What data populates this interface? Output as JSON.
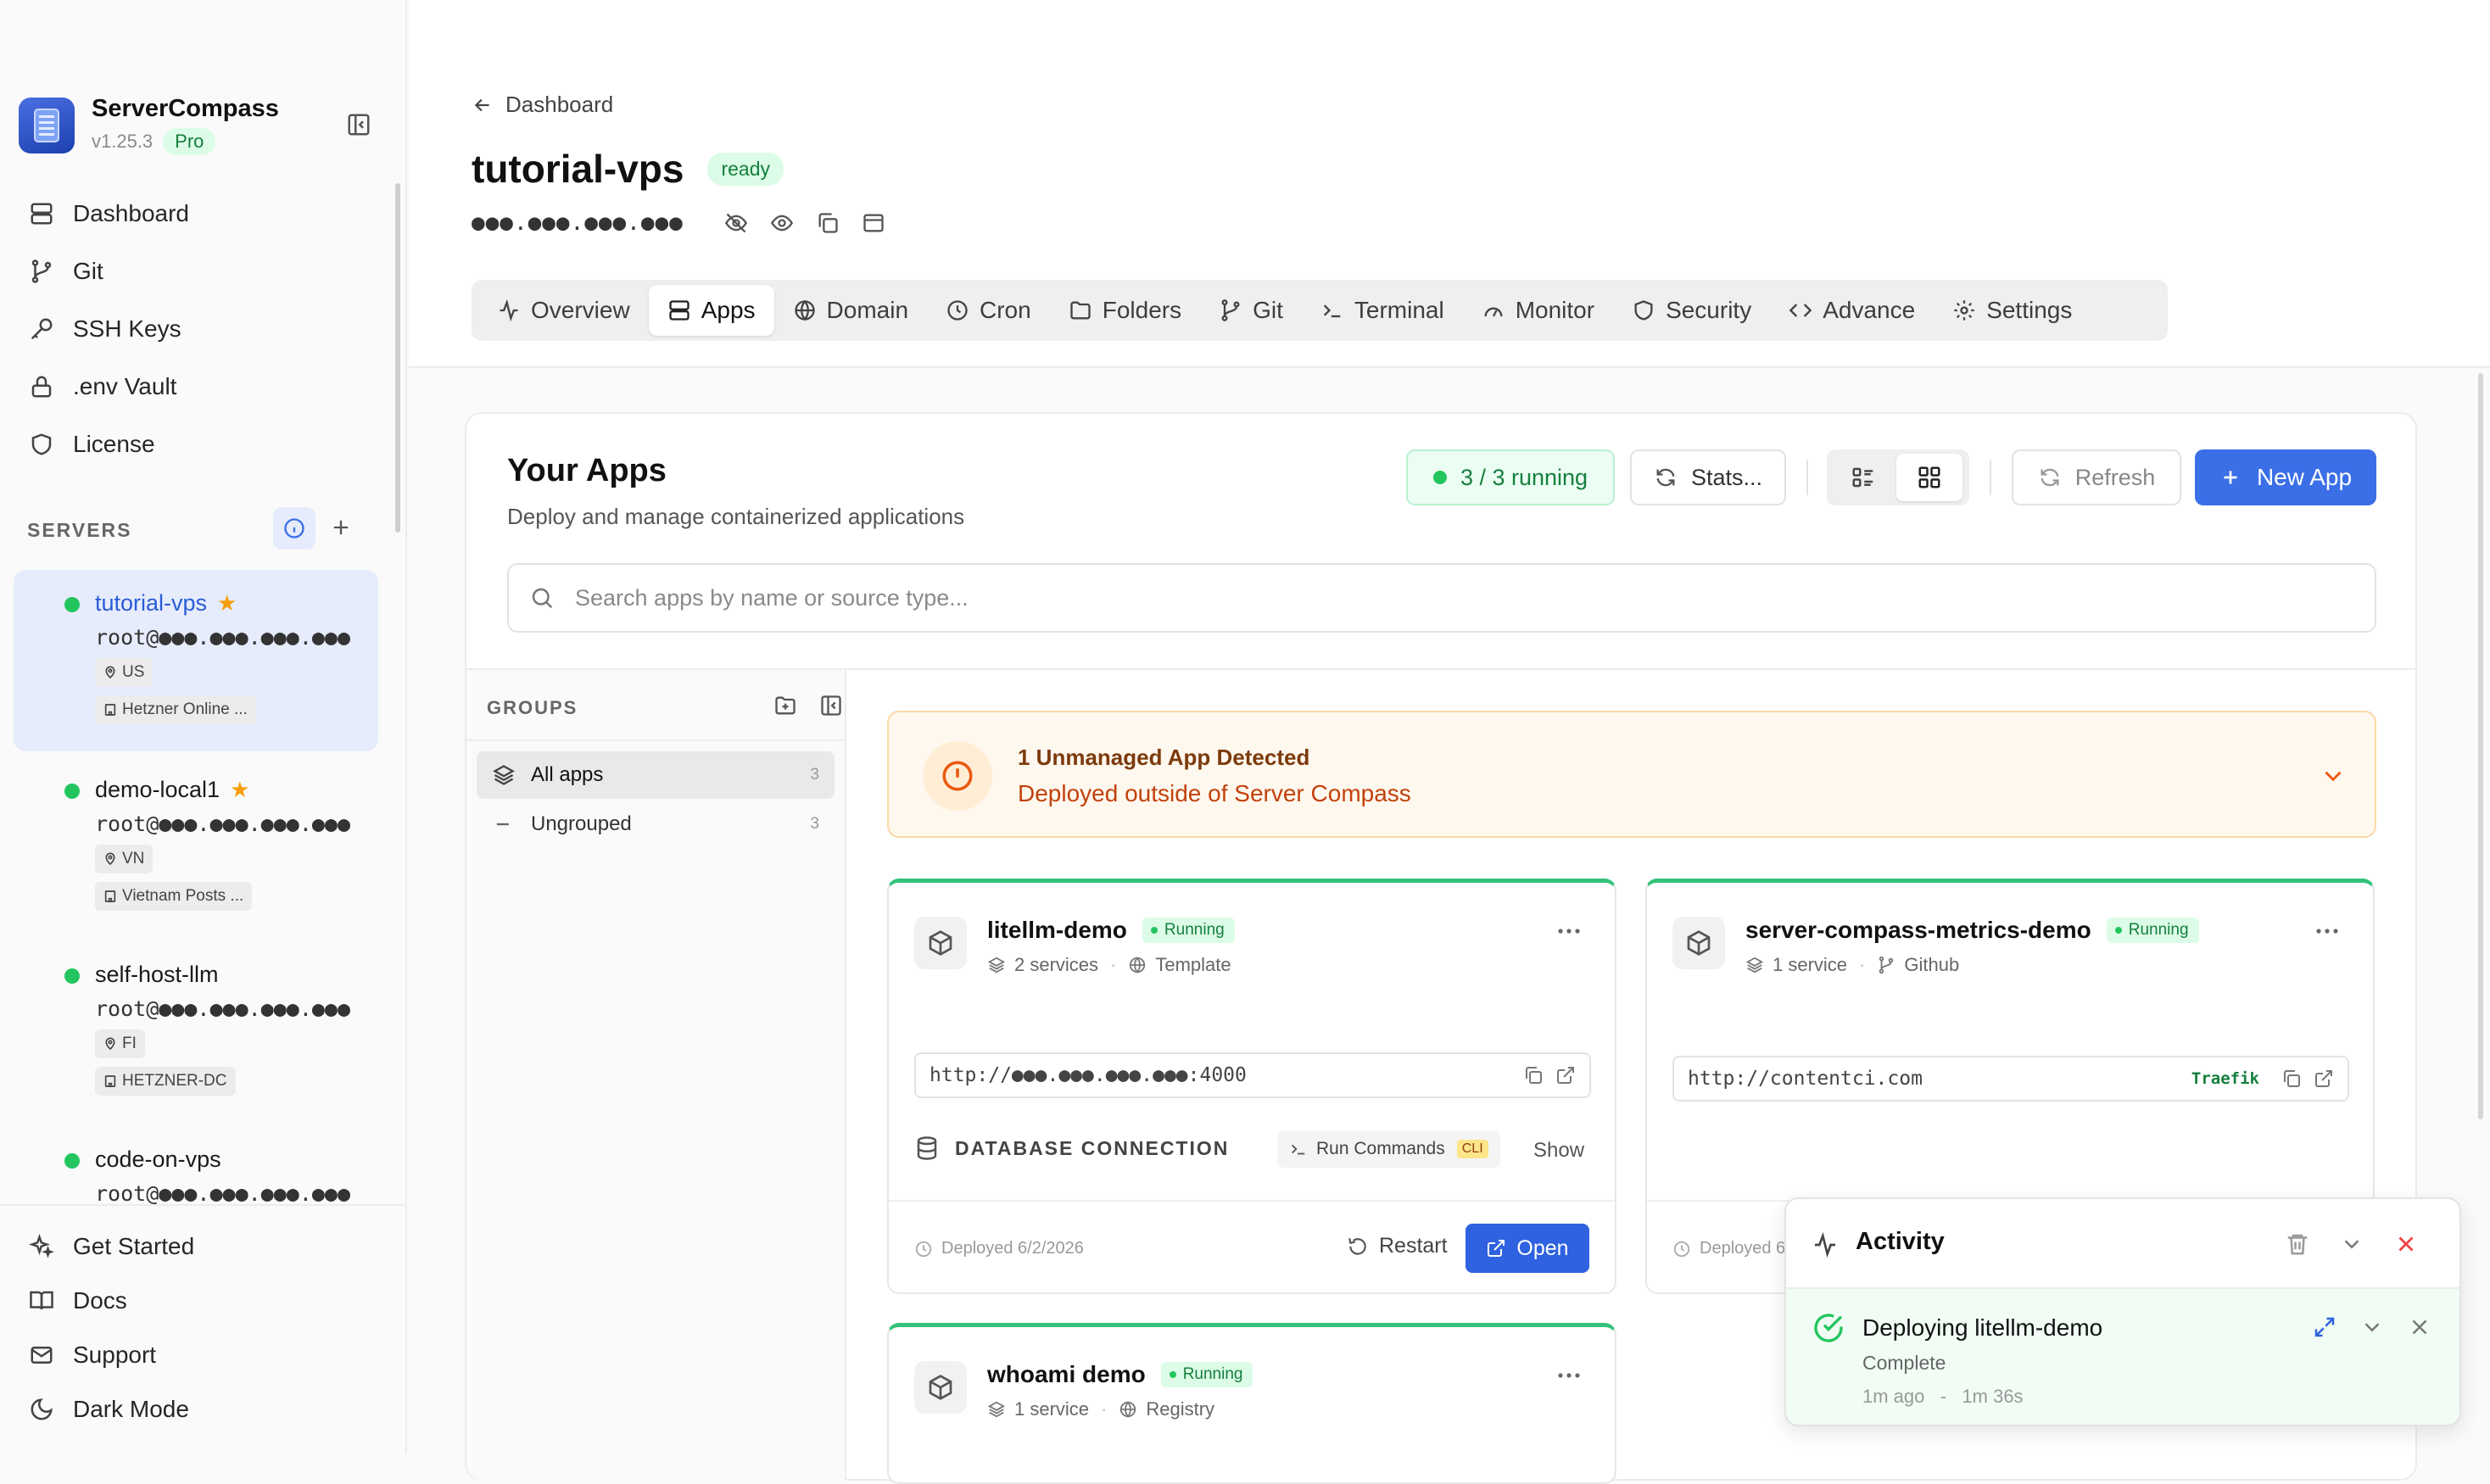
{
  "app": {
    "name": "ServerCompass",
    "version": "v1.25.3",
    "plan": "Pro"
  },
  "colors": {
    "accent": "#3b6fe8",
    "success": "#22c55e",
    "warning": "#c2410c",
    "danger": "#ef4444"
  },
  "sidebar": {
    "nav": [
      {
        "label": "Dashboard",
        "icon": "server-stack-icon"
      },
      {
        "label": "Git",
        "icon": "git-branch-icon"
      },
      {
        "label": "SSH Keys",
        "icon": "key-icon"
      },
      {
        "label": ".env Vault",
        "icon": "lock-icon"
      },
      {
        "label": "License",
        "icon": "shield-icon"
      }
    ],
    "servers_title": "SERVERS",
    "servers": [
      {
        "name": "tutorial-vps",
        "user": "root@●●●.●●●.●●●.●●●",
        "country": "US",
        "provider": "Hetzner Online ...",
        "starred": true,
        "active": true
      },
      {
        "name": "demo-local1",
        "user": "root@●●●.●●●.●●●.●●●",
        "country": "VN",
        "provider": "Vietnam Posts ...",
        "starred": true,
        "active": false
      },
      {
        "name": "self-host-llm",
        "user": "root@●●●.●●●.●●●.●●●",
        "country": "FI",
        "provider": "HETZNER-DC",
        "starred": false,
        "active": false
      },
      {
        "name": "code-on-vps",
        "user": "root@●●●.●●●.●●●.●●●",
        "starred": false,
        "active": false
      }
    ],
    "bottom": [
      {
        "label": "Get Started",
        "icon": "sparkles-icon"
      },
      {
        "label": "Docs",
        "icon": "book-icon"
      },
      {
        "label": "Support",
        "icon": "mail-icon"
      },
      {
        "label": "Dark Mode",
        "icon": "moon-icon"
      }
    ]
  },
  "header": {
    "back_label": "Dashboard",
    "title": "tutorial-vps",
    "status": "ready",
    "ip": "●●●.●●●.●●●.●●●",
    "tabs": [
      {
        "label": "Overview",
        "icon": "activity-icon"
      },
      {
        "label": "Apps",
        "icon": "server-stack-icon",
        "active": true
      },
      {
        "label": "Domain",
        "icon": "globe-icon"
      },
      {
        "label": "Cron",
        "icon": "clock-icon"
      },
      {
        "label": "Folders",
        "icon": "folder-icon"
      },
      {
        "label": "Git",
        "icon": "git-branch-icon"
      },
      {
        "label": "Terminal",
        "icon": "terminal-icon"
      },
      {
        "label": "Monitor",
        "icon": "gauge-icon"
      },
      {
        "label": "Security",
        "icon": "shield-icon"
      },
      {
        "label": "Advance",
        "icon": "code-icon"
      },
      {
        "label": "Settings",
        "icon": "gear-icon"
      }
    ]
  },
  "apps_panel": {
    "title": "Your Apps",
    "subtitle": "Deploy and manage containerized applications",
    "running": "3 / 3 running",
    "stats_label": "Stats...",
    "refresh_label": "Refresh",
    "new_app_label": "New App",
    "search_placeholder": "Search apps by name or source type...",
    "groups_title": "GROUPS",
    "groups": [
      {
        "label": "All apps",
        "count": "3",
        "active": true
      },
      {
        "label": "Ungrouped",
        "count": "3",
        "active": false
      }
    ],
    "alert": {
      "title": "1 Unmanaged App Detected",
      "subtitle": "Deployed outside of Server Compass"
    },
    "apps": [
      {
        "name": "litellm-demo",
        "status": "Running",
        "services": "2 services",
        "source": "Template",
        "url": "http://●●●.●●●.●●●.●●●:4000",
        "db_label": "DATABASE CONNECTION",
        "run_label": "Run Commands",
        "cli": "CLI",
        "show": "Show",
        "deployed": "Deployed 6/2/2026",
        "restart": "Restart",
        "open": "Open"
      },
      {
        "name": "server-compass-metrics-demo",
        "status": "Running",
        "services": "1 service",
        "source": "Github",
        "url": "http://contentci.com",
        "proxy": "Traefik",
        "deployed": "Deployed 6"
      },
      {
        "name": "whoami demo",
        "status": "Running",
        "services": "1 service",
        "source": "Registry"
      }
    ]
  },
  "activity": {
    "title": "Activity",
    "job": "Deploying litellm-demo",
    "status": "Complete",
    "ago": "1m ago",
    "separator": "-",
    "duration": "1m 36s"
  }
}
